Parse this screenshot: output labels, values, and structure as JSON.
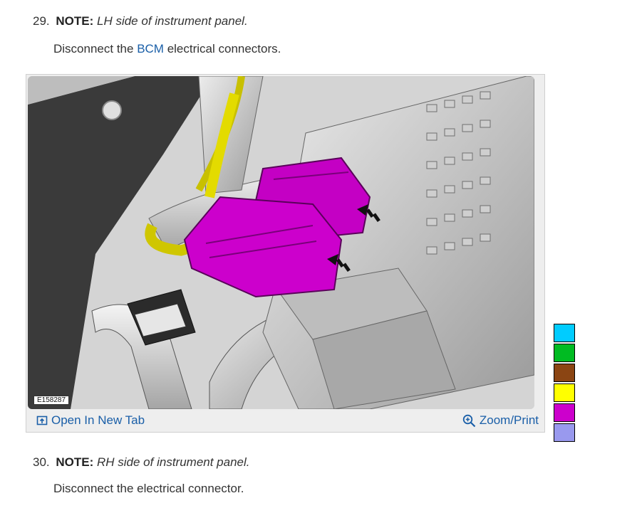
{
  "steps": [
    {
      "number": "29.",
      "note_label": "NOTE:",
      "note_text": "LH side of instrument panel.",
      "instruction_before": "Disconnect the ",
      "instruction_link": "BCM",
      "instruction_after": " electrical connectors."
    },
    {
      "number": "30.",
      "note_label": "NOTE:",
      "note_text": "RH side of instrument panel.",
      "instruction": "Disconnect the electrical connector."
    }
  ],
  "figure": {
    "image_id": "E158287",
    "open_tab_label": "Open In New Tab",
    "zoom_label": "Zoom/Print",
    "open_tab_icon": "open-in-new-tab-icon",
    "zoom_icon": "magnifier-plus-icon"
  },
  "color_swatches": [
    "#00ccff",
    "#00bb22",
    "#8b4513",
    "#ffff00",
    "#cc00cc",
    "#9999ee"
  ],
  "accent_link_color": "#1a5fa8"
}
